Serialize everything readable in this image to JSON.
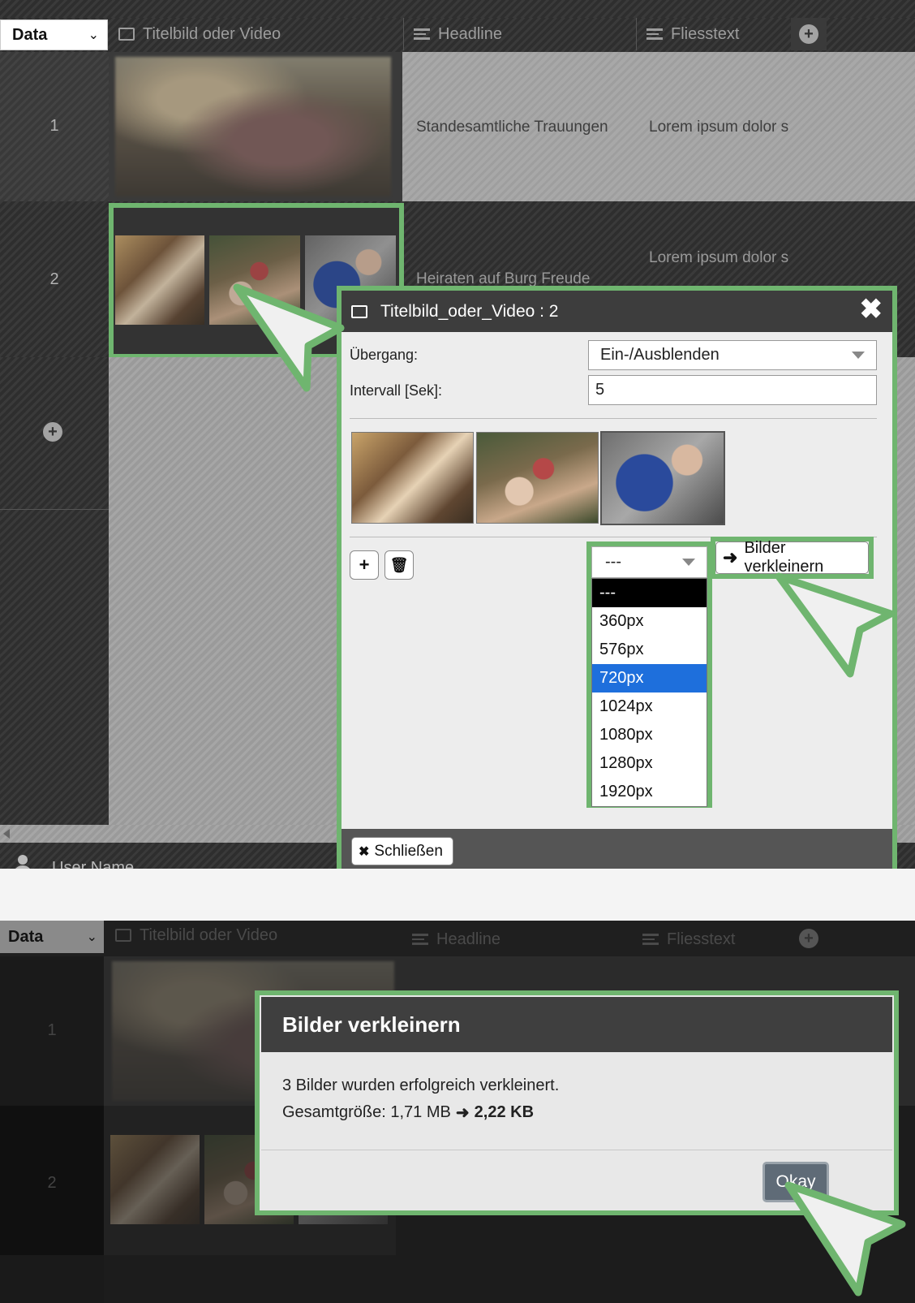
{
  "top": {
    "data_select": "Data",
    "columns": [
      "Titelbild oder Video",
      "Headline",
      "Fliesstext"
    ],
    "rows": [
      {
        "num": "1",
        "headline": "Standesamtliche Trauungen",
        "text": "Lorem ipsum dolor s"
      },
      {
        "num": "2",
        "headline": "Heiraten auf Burg Freude",
        "text": "Lorem ipsum dolor s"
      }
    ],
    "user_name": "User Name"
  },
  "dialog": {
    "title": "Titelbild_oder_Video : 2",
    "transition_label": "Übergang:",
    "transition_value": "Ein-/Ausblenden",
    "interval_label": "Intervall [Sek]:",
    "interval_value": "5",
    "resize_select_value": "---",
    "resize_options": [
      "---",
      "360px",
      "576px",
      "720px",
      "1024px",
      "1080px",
      "1280px",
      "1920px"
    ],
    "resize_selected": "720px",
    "resize_button": "Bilder verkleinern",
    "close_button": "Schließen"
  },
  "bottom": {
    "data_select": "Data",
    "columns": [
      "Titelbild oder Video",
      "Headline",
      "Fliesstext"
    ],
    "rows": [
      "1",
      "2"
    ]
  },
  "popup": {
    "title": "Bilder verkleinern",
    "line1": "3 Bilder wurden erfolgreich verkleinert.",
    "line2_prefix": "Gesamtgröße: 1,71 MB",
    "line2_result": "2,22 KB",
    "ok_button": "Okay"
  },
  "colors": {
    "highlight": "#6fb56f",
    "selected_option": "#1e6fdc",
    "title_bar": "#3d3d3d"
  },
  "icons": [
    "image-icon",
    "text-lines-icon",
    "add-column-icon",
    "add-row-icon",
    "user-icon",
    "close-icon",
    "plus-icon",
    "trash-icon",
    "arrow-right-icon",
    "cursor-pointer-icon"
  ]
}
